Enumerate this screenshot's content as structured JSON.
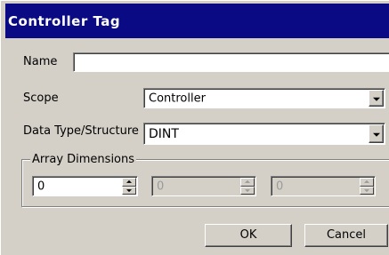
{
  "dialog": {
    "title": "Controller Tag"
  },
  "form": {
    "name_label": "Name",
    "name_value": "",
    "scope_label": "Scope",
    "scope_value": "Controller",
    "data_type_label": "Data Type/Structure",
    "data_type_value": "DINT",
    "array_dimensions_label": "Array Dimensions",
    "dimensions": [
      {
        "value": "0",
        "enabled": true
      },
      {
        "value": "0",
        "enabled": false
      },
      {
        "value": "0",
        "enabled": false
      }
    ]
  },
  "buttons": {
    "ok_label": "OK",
    "cancel_label": "Cancel"
  },
  "icons": {
    "combo_arrow": "chevron-down-icon",
    "spin_up": "spin-up-icon",
    "spin_down": "spin-down-icon"
  },
  "colors": {
    "titlebar": "#0a0a84",
    "face": "#d4d0c8"
  }
}
